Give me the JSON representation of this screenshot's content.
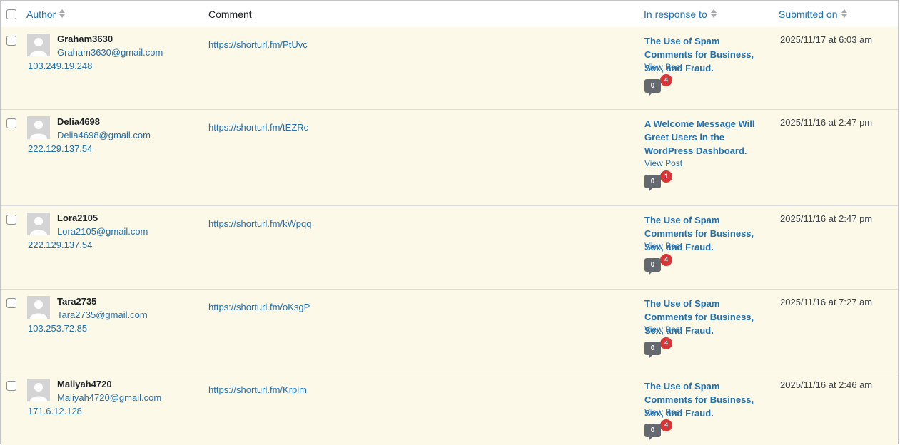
{
  "columns": {
    "author": "Author",
    "comment": "Comment",
    "in_response_to": "In response to",
    "submitted_on": "Submitted on"
  },
  "colors": {
    "link": "#2271b1",
    "row_unapproved_bg": "#fcf9e8",
    "pending_badge": "#d63638",
    "count_bubble": "#646970"
  },
  "rows": [
    {
      "author_name": "Graham3630",
      "author_email": "Graham3630@gmail.com",
      "author_ip": "103.249.19.248",
      "comment": "https://shorturl.fm/PtUvc",
      "post_title": "The Use of Spam Comments for Business, Sex, and Fraud.",
      "view_post": "View Post",
      "approved_count": "0",
      "pending_count": "4",
      "submitted_on": "2025/11/17 at 6:03 am"
    },
    {
      "author_name": "Delia4698",
      "author_email": "Delia4698@gmail.com",
      "author_ip": "222.129.137.54",
      "comment": "https://shorturl.fm/tEZRc",
      "post_title": "A Welcome Message Will Greet Users in the WordPress Dashboard.",
      "view_post": "View Post",
      "approved_count": "0",
      "pending_count": "1",
      "submitted_on": "2025/11/16 at 2:47 pm"
    },
    {
      "author_name": "Lora2105",
      "author_email": "Lora2105@gmail.com",
      "author_ip": "222.129.137.54",
      "comment": "https://shorturl.fm/kWpqq",
      "post_title": "The Use of Spam Comments for Business, Sex, and Fraud.",
      "view_post": "View Post",
      "approved_count": "0",
      "pending_count": "4",
      "submitted_on": "2025/11/16 at 2:47 pm"
    },
    {
      "author_name": "Tara2735",
      "author_email": "Tara2735@gmail.com",
      "author_ip": "103.253.72.85",
      "comment": "https://shorturl.fm/oKsgP",
      "post_title": "The Use of Spam Comments for Business, Sex, and Fraud.",
      "view_post": "View Post",
      "approved_count": "0",
      "pending_count": "4",
      "submitted_on": "2025/11/16 at 7:27 am"
    },
    {
      "author_name": "Maliyah4720",
      "author_email": "Maliyah4720@gmail.com",
      "author_ip": "171.6.12.128",
      "comment": "https://shorturl.fm/Krplm",
      "post_title": "The Use of Spam Comments for Business, Sex, and Fraud.",
      "view_post": "View Post",
      "approved_count": "0",
      "pending_count": "4",
      "submitted_on": "2025/11/16 at 2:46 am"
    }
  ]
}
